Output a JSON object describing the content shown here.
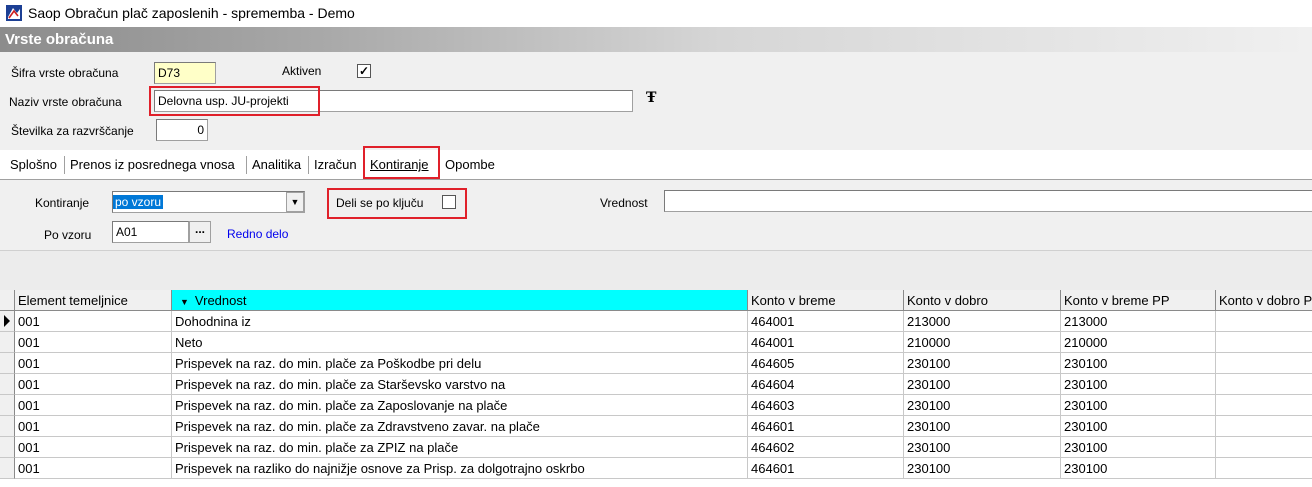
{
  "window": {
    "title": "Saop Obračun plač zaposlenih - sprememba - Demo"
  },
  "section": {
    "title": "Vrste obračuna"
  },
  "form": {
    "sifra_label": "Šifra vrste obračuna",
    "sifra_value": "D73",
    "aktiven_label": "Aktiven",
    "aktiven_checked": "✓",
    "naziv_label": "Naziv vrste obračuna",
    "naziv_value": "Delovna usp. JU-projekti",
    "stevilka_label": "Številka  za razvrščanje",
    "stevilka_value": "0"
  },
  "tabs": [
    {
      "label": "Splošno"
    },
    {
      "label": "Prenos iz posrednega vnosa"
    },
    {
      "label": "Analitika"
    },
    {
      "label": "Izračun"
    },
    {
      "label": "Kontiranje"
    },
    {
      "label": "Opombe"
    }
  ],
  "kontiranje": {
    "kontiranje_label": "Kontiranje",
    "kontiranje_value": "po vzoru",
    "deli_label": "Deli se po ključu",
    "vrednost_label": "Vrednost",
    "vrednost_value": "",
    "po_vzoru_label": "Po vzoru",
    "po_vzoru_value": "A01",
    "po_vzoru_desc": "Redno delo",
    "ellipsis": "..."
  },
  "grid": {
    "columns": [
      "Element temeljnice",
      "Vrednost",
      "Konto v breme",
      "Konto v dobro",
      "Konto v breme PP",
      "Konto v dobro PP"
    ],
    "sorted_column_marker": "▼",
    "rows": [
      [
        "001",
        "Dohodnina iz",
        "464001",
        "213000",
        "213000",
        ""
      ],
      [
        "001",
        "Neto",
        "464001",
        "210000",
        "210000",
        ""
      ],
      [
        "001",
        "Prispevek na raz. do min. plače za Poškodbe pri delu",
        "464605",
        "230100",
        "230100",
        ""
      ],
      [
        "001",
        "Prispevek na raz. do min. plače za Starševsko varstvo na",
        "464604",
        "230100",
        "230100",
        ""
      ],
      [
        "001",
        "Prispevek na raz. do min. plače za Zaposlovanje na plače",
        "464603",
        "230100",
        "230100",
        ""
      ],
      [
        "001",
        "Prispevek na raz. do min. plače za Zdravstveno zavar. na plače",
        "464601",
        "230100",
        "230100",
        ""
      ],
      [
        "001",
        "Prispevek na raz. do min. plače za ZPIZ na plače",
        "464602",
        "230100",
        "230100",
        ""
      ],
      [
        "001",
        "Prispevek na razliko do najnižje osnove za Prisp. za dolgotrajno oskrbo",
        "464601",
        "230100",
        "230100",
        ""
      ]
    ]
  },
  "colors": {
    "highlight": "#e0202a",
    "sorted_header": "#00ffff",
    "link": "#0000ee",
    "selection": "#0078d7"
  }
}
